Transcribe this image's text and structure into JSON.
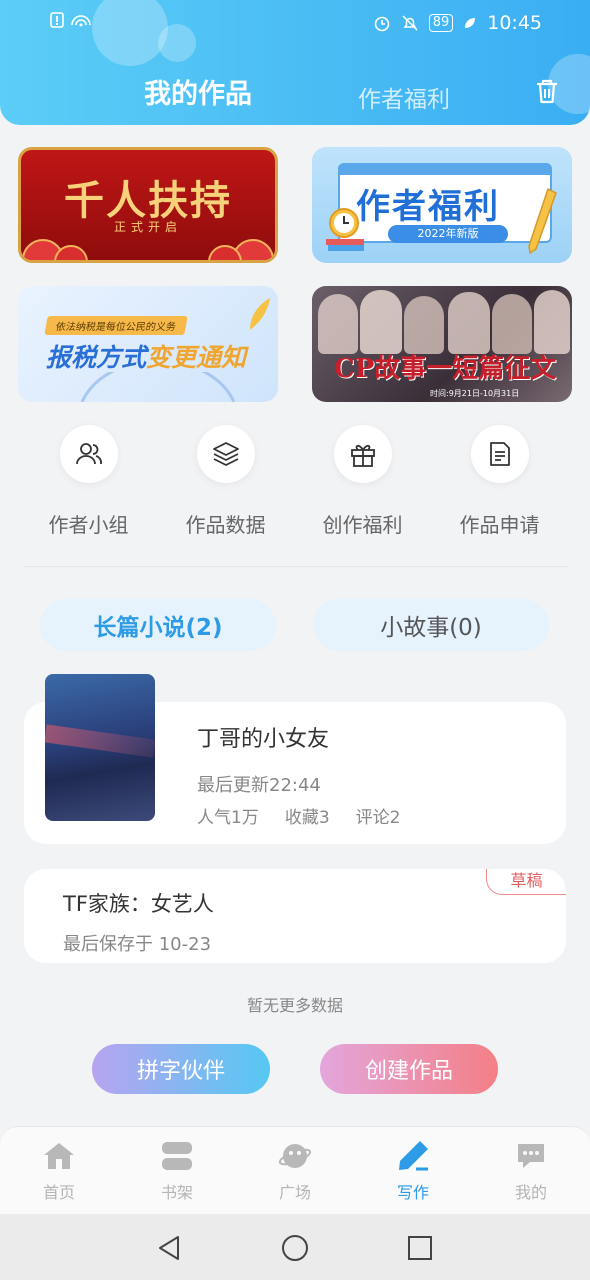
{
  "status_bar": {
    "time": "10:45",
    "battery": "89"
  },
  "header": {
    "tabs": [
      {
        "label": "我的作品",
        "active": true
      },
      {
        "label": "作者福利",
        "active": false
      }
    ]
  },
  "banners": [
    {
      "title": "千人扶持",
      "subtitle": "正式开启"
    },
    {
      "title": "作者福利",
      "subtitle": "2022年新版"
    },
    {
      "kicker": "依法纳税是每位公民的义务",
      "title_a": "报税方式",
      "title_b": "变更通知"
    },
    {
      "title": "CP故事一短篇征文",
      "date": "时间:9月21日-10月31日"
    }
  ],
  "quick_actions": [
    {
      "label": "作者小组",
      "icon": "author-group-icon"
    },
    {
      "label": "作品数据",
      "icon": "layers-icon"
    },
    {
      "label": "创作福利",
      "icon": "gift-icon"
    },
    {
      "label": "作品申请",
      "icon": "document-icon"
    }
  ],
  "segments": [
    {
      "label": "长篇小说(2)",
      "active": true
    },
    {
      "label": "小故事(0)",
      "active": false
    }
  ],
  "works": [
    {
      "title": "丁哥的小女友",
      "updated": "最后更新22:44",
      "popularity": "人气1万",
      "favorites": "收藏3",
      "comments": "评论2"
    },
    {
      "title": "TF家族：女艺人",
      "saved": "最后保存于 10-23",
      "badge": "草稿"
    }
  ],
  "no_more": "暂无更多数据",
  "actions": {
    "pinzi": "拼字伙伴",
    "create": "创建作品"
  },
  "tabbar": [
    {
      "label": "首页",
      "icon": "home-icon"
    },
    {
      "label": "书架",
      "icon": "bookshelf-icon"
    },
    {
      "label": "广场",
      "icon": "planet-icon"
    },
    {
      "label": "写作",
      "icon": "pen-icon",
      "active": true
    },
    {
      "label": "我的",
      "icon": "chat-icon"
    }
  ],
  "colors": {
    "accent": "#2e9be6",
    "header_start": "#5ccdf6",
    "header_end": "#3aaef3",
    "draft": "#e26060"
  }
}
